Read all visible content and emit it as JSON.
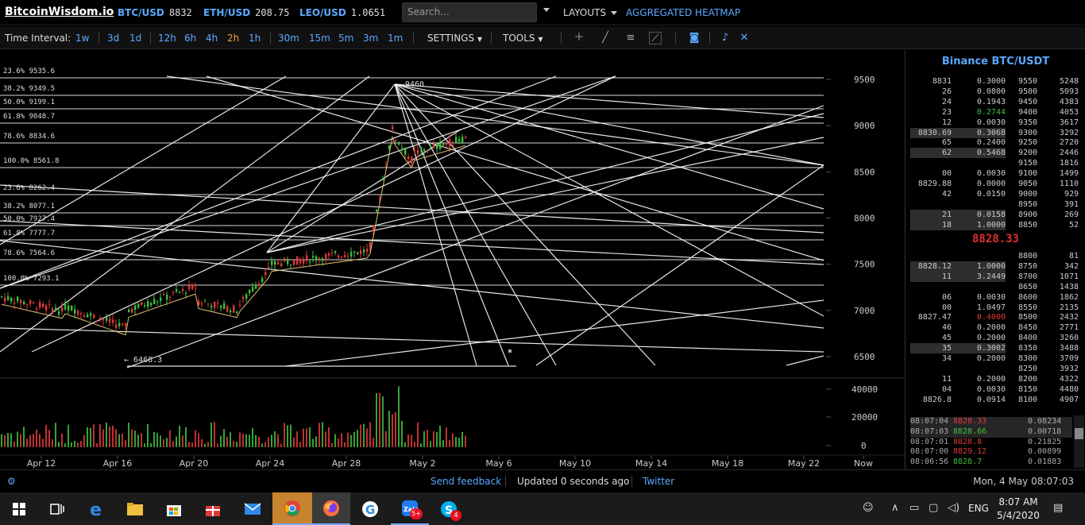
{
  "header": {
    "logo": "BitcoinWisdom.io",
    "tickers": [
      {
        "symbol": "BTC/USD",
        "price": "8832"
      },
      {
        "symbol": "ETH/USD",
        "price": "208.75"
      },
      {
        "symbol": "LEO/USD",
        "price": "1.0651"
      }
    ],
    "search_placeholder": "Search...",
    "layouts_label": "LAYOUTS",
    "heatmap_label": "AGGREGATED HEATMAP"
  },
  "toolbar": {
    "interval_label": "Time Interval:",
    "intervals": [
      "1w",
      "3d",
      "1d",
      "12h",
      "6h",
      "4h",
      "2h",
      "1h",
      "30m",
      "15m",
      "5m",
      "3m",
      "1m"
    ],
    "active_interval": "2h",
    "settings_label": "SETTINGS",
    "tools_label": "TOOLS",
    "icons": [
      "crosshair-icon",
      "trendline-icon",
      "horizontal-lines-icon",
      "fib-tool-icon",
      "camera-icon",
      "bell-icon",
      "fullscreen-icon"
    ]
  },
  "chart": {
    "price_axis": [
      "9500",
      "9000",
      "8500",
      "8000",
      "7500",
      "7000",
      "6500"
    ],
    "volume_axis": [
      "40000",
      "20000",
      "0"
    ],
    "time_axis": [
      "Apr 12",
      "Apr 16",
      "Apr 20",
      "Apr 24",
      "Apr 28",
      "May 2",
      "May 6",
      "May 10",
      "May 14",
      "May 18",
      "May 22",
      "Now"
    ],
    "fib_labels": [
      "23.6% 9535.6",
      "38.2% 9349.5",
      "50.0% 9199.1",
      "61.8% 9048.7",
      "78.6% 8834.6",
      "100.0% 8561.8",
      "23.6% 8262.4",
      "38.2% 8077.1",
      "50.0% 7927.4",
      "61.8% 7777.7",
      "78.6% 7564.6",
      "100.0% 7293.1"
    ],
    "high_marker": "9460",
    "low_marker": "← 6468.3",
    "colors": {
      "up": "#3fbf3f",
      "down": "#e03a3a",
      "lines": "#ffffff",
      "ma": "#e0c070"
    }
  },
  "book": {
    "title": "Binance BTC/USDT",
    "asks": [
      {
        "price": "8831",
        "amount": "0.3000",
        "level": "9550",
        "total": "5248"
      },
      {
        "price": "26",
        "amount": "0.0800",
        "level": "9500",
        "total": "5093"
      },
      {
        "price": "24",
        "amount": "0.1943",
        "level": "9450",
        "total": "4383"
      },
      {
        "price": "23",
        "amount": "0.2744",
        "level": "9400",
        "total": "4053"
      },
      {
        "price": "12",
        "amount": "0.0030",
        "level": "9350",
        "total": "3617"
      },
      {
        "price": "8830.69",
        "amount": "0.3068",
        "level": "9300",
        "total": "3292"
      },
      {
        "price": "65",
        "amount": "0.2400",
        "level": "9250",
        "total": "2720"
      },
      {
        "price": "62",
        "amount": "0.5468",
        "level": "9200",
        "total": "2446"
      },
      {
        "price": "",
        "amount": "",
        "level": "9150",
        "total": "1816"
      },
      {
        "price": "00",
        "amount": "0.0030",
        "level": "9100",
        "total": "1499"
      },
      {
        "price": "8829.88",
        "amount": "0.0000",
        "level": "9050",
        "total": "1110"
      },
      {
        "price": "42",
        "amount": "0.0150",
        "level": "9000",
        "total": "929"
      },
      {
        "price": "",
        "amount": "",
        "level": "8950",
        "total": "391"
      },
      {
        "price": "21",
        "amount": "0.0158",
        "level": "8900",
        "total": "269"
      },
      {
        "price": "18",
        "amount": "1.0000",
        "level": "8850",
        "total": "52"
      }
    ],
    "mid_price": "8828.33",
    "bids": [
      {
        "price": "",
        "amount": "",
        "level": "8800",
        "total": "81"
      },
      {
        "price": "8828.12",
        "amount": "1.0000",
        "level": "8750",
        "total": "342"
      },
      {
        "price": "11",
        "amount": "3.2449",
        "level": "8700",
        "total": "1071"
      },
      {
        "price": "",
        "amount": "",
        "level": "8650",
        "total": "1438"
      },
      {
        "price": "06",
        "amount": "0.0030",
        "level": "8600",
        "total": "1862"
      },
      {
        "price": "00",
        "amount": "1.0497",
        "level": "8550",
        "total": "2135"
      },
      {
        "price": "8827.47",
        "amount": "0.4000",
        "level": "8500",
        "total": "2432"
      },
      {
        "price": "46",
        "amount": "0.2000",
        "level": "8450",
        "total": "2771"
      },
      {
        "price": "45",
        "amount": "0.2000",
        "level": "8400",
        "total": "3260"
      },
      {
        "price": "35",
        "amount": "0.3002",
        "level": "8350",
        "total": "3488"
      },
      {
        "price": "34",
        "amount": "0.2000",
        "level": "8300",
        "total": "3709"
      },
      {
        "price": "",
        "amount": "",
        "level": "8250",
        "total": "3932"
      },
      {
        "price": "11",
        "amount": "0.2000",
        "level": "8200",
        "total": "4322"
      },
      {
        "price": "04",
        "amount": "0.0030",
        "level": "8150",
        "total": "4480"
      },
      {
        "price": "8826.8",
        "amount": "0.0914",
        "level": "8100",
        "total": "4907"
      }
    ],
    "trades": [
      {
        "time": "08:07:04",
        "price": "8828.33",
        "amount": "0.08234",
        "side": "sell"
      },
      {
        "time": "08:07:03",
        "price": "8828.66",
        "amount": "0.00718",
        "side": "buy"
      },
      {
        "time": "08:07:01",
        "price": "8828.8",
        "amount": "0.21825",
        "side": "sell"
      },
      {
        "time": "08:07:00",
        "price": "8829.12",
        "amount": "0.00899",
        "side": "sell"
      },
      {
        "time": "08:06:56",
        "price": "8828.7",
        "amount": "0.01883",
        "side": "buy"
      }
    ]
  },
  "status": {
    "feedback": "Send feedback",
    "updated": "Updated 0 seconds ago",
    "twitter": "Twitter",
    "datetime": "Mon, 4 May 08:07:03"
  },
  "taskbar": {
    "apps": [
      "start-icon",
      "task-view-icon",
      "edge-icon",
      "file-explorer-icon",
      "store-icon",
      "gift-icon",
      "mail-icon",
      "chrome-icon",
      "firefox-icon",
      "g-app-icon",
      "zalo-icon",
      "skype-icon"
    ],
    "zalo_badge": "5+",
    "skype_badge": "4",
    "language": "ENG",
    "time": "8:07 AM",
    "date": "5/4/2020"
  }
}
